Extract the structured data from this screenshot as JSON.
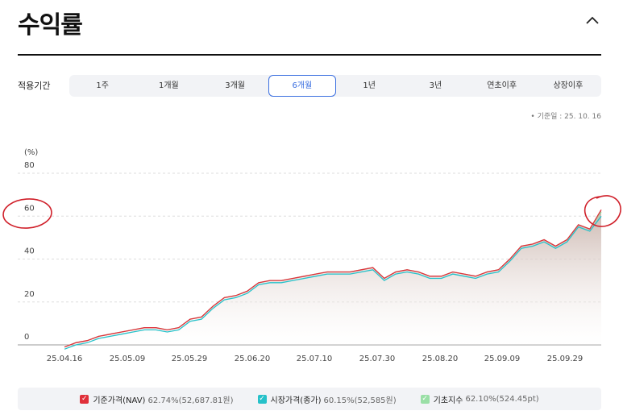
{
  "header": {
    "title": "수익률"
  },
  "period": {
    "label": "적용기간",
    "tabs": [
      "1주",
      "1개월",
      "3개월",
      "6개월",
      "1년",
      "3년",
      "연초이후",
      "상장이후"
    ],
    "active_index": 3
  },
  "base_date": "• 기준일 : 25. 10. 16",
  "colors": {
    "nav": "#e0303a",
    "market": "#26c1c9",
    "index": "#9adfa6",
    "accent": "#3b6fe0",
    "area": "#c9b3ab"
  },
  "legend": [
    {
      "name": "기준가격(NAV)",
      "value": "62.74%(52,687.81원)",
      "color": "#e0303a",
      "icon": "check-icon"
    },
    {
      "name": "시장가격(종가)",
      "value": "60.15%(52,585원)",
      "color": "#26c1c9",
      "icon": "check-icon"
    },
    {
      "name": "기초지수",
      "value": "62.10%(524.45pt)",
      "color": "#9adfa6",
      "icon": "check-icon"
    }
  ],
  "chart_data": {
    "type": "area",
    "ylabel": "(%)",
    "ylim": [
      0,
      80
    ],
    "yticks": [
      "0",
      "20",
      "40",
      "60",
      "80"
    ],
    "xticks": [
      "25.04.16",
      "25.05.09",
      "25.05.29",
      "25.06.20",
      "25.07.10",
      "25.07.30",
      "25.08.20",
      "25.09.09",
      "25.09.29"
    ],
    "grid": true,
    "x": [
      "25.04.16",
      "25.04.21",
      "25.04.24",
      "25.04.29",
      "25.05.02",
      "25.05.07",
      "25.05.09",
      "25.05.14",
      "25.05.19",
      "25.05.22",
      "25.05.27",
      "25.05.29",
      "25.06.02",
      "25.06.05",
      "25.06.10",
      "25.06.13",
      "25.06.18",
      "25.06.20",
      "25.06.25",
      "25.06.30",
      "25.07.03",
      "25.07.08",
      "25.07.10",
      "25.07.15",
      "25.07.18",
      "25.07.23",
      "25.07.28",
      "25.07.30",
      "25.08.01",
      "25.08.06",
      "25.08.11",
      "25.08.14",
      "25.08.20",
      "25.08.25",
      "25.08.28",
      "25.09.02",
      "25.09.05",
      "25.09.09",
      "25.09.12",
      "25.09.17",
      "25.09.22",
      "25.09.25",
      "25.09.29",
      "25.10.02",
      "25.10.07",
      "25.10.10",
      "25.10.13",
      "25.10.16"
    ],
    "series": [
      {
        "name": "기준가격(NAV)",
        "values": [
          -1,
          1,
          2,
          4,
          5,
          6,
          7,
          8,
          8,
          7,
          8,
          12,
          13,
          18,
          22,
          23,
          25,
          29,
          30,
          30,
          31,
          32,
          33,
          34,
          34,
          34,
          35,
          36,
          31,
          34,
          35,
          34,
          32,
          32,
          34,
          33,
          32,
          34,
          35,
          40,
          46,
          47,
          49,
          46,
          49,
          56,
          54,
          63
        ]
      },
      {
        "name": "시장가격(종가)",
        "values": [
          -2,
          0,
          1,
          3,
          4,
          5,
          6,
          7,
          7,
          6,
          7,
          11,
          12,
          17,
          21,
          22,
          24,
          28,
          29,
          29,
          30,
          31,
          32,
          33,
          33,
          33,
          34,
          35,
          30,
          33,
          34,
          33,
          31,
          31,
          33,
          32,
          31,
          33,
          34,
          39,
          45,
          46,
          48,
          45,
          48,
          55,
          53,
          60
        ]
      },
      {
        "name": "기초지수",
        "values": [
          -1,
          1,
          2,
          4,
          5,
          6,
          7,
          8,
          8,
          7,
          8,
          12,
          13,
          18,
          22,
          23,
          25,
          29,
          30,
          30,
          31,
          32,
          33,
          34,
          34,
          34,
          35,
          36,
          31,
          34,
          35,
          34,
          32,
          32,
          34,
          33,
          32,
          34,
          35,
          40,
          46,
          47,
          49,
          46,
          49,
          56,
          54,
          62
        ]
      }
    ]
  }
}
